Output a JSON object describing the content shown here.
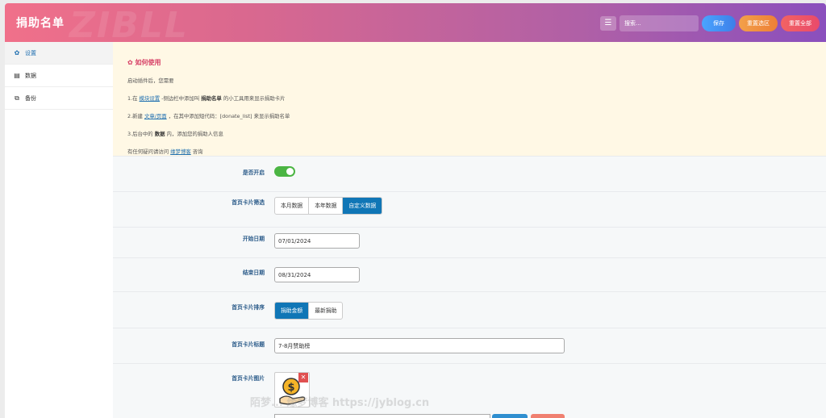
{
  "header": {
    "title": "捐助名单",
    "search_placeholder": "搜索...",
    "save_label": "保存",
    "reset_section_label": "重置选区",
    "reset_all_label": "重置全部"
  },
  "sidebar": {
    "items": [
      {
        "label": "设置",
        "icon": "gear-icon",
        "active": true
      },
      {
        "label": "数据",
        "icon": "table-icon",
        "active": false
      },
      {
        "label": "备份",
        "icon": "copy-icon",
        "active": false
      }
    ]
  },
  "notice": {
    "title": "如何使用",
    "intro": "启动插件后，您需要",
    "step1_a": "1.在",
    "step1_link": "模块设置",
    "step1_b": "-侧边栏中添加叫",
    "step1_bold": "捐助名单",
    "step1_c": "的小工具用来显示捐助卡片",
    "step2_a": "2.新建",
    "step2_link": "文章/页面",
    "step2_b": "，在其中添加短代码：[donate_list] 来显示捐助名单",
    "step3_a": "3.后台中的",
    "step3_bold": "数据",
    "step3_b": "内，添加您的捐助人信息",
    "contact_a": "有任何疑问请访问",
    "contact_link": "缘梦博客",
    "contact_b": "咨询"
  },
  "fields": {
    "enabled_label": "是否开启",
    "enabled": true,
    "card_filter_label": "首页卡片筛选",
    "card_filter_options": [
      "本月数据",
      "本年数据",
      "自定义数据"
    ],
    "card_filter_selected": "自定义数据",
    "start_date_label": "开始日期",
    "start_date_value": "07/01/2024",
    "end_date_label": "结束日期",
    "end_date_value": "08/31/2024",
    "card_sort_label": "首页卡片排序",
    "card_sort_options": [
      "捐助金额",
      "最新捐助"
    ],
    "card_sort_selected": "捐助金额",
    "card_title_label": "首页卡片标题",
    "card_title_value": "7-8月赞助榜",
    "card_image_label": "首页卡片图片"
  },
  "watermark": "陌梦... 缘梦博客 https://jyblog.cn"
}
